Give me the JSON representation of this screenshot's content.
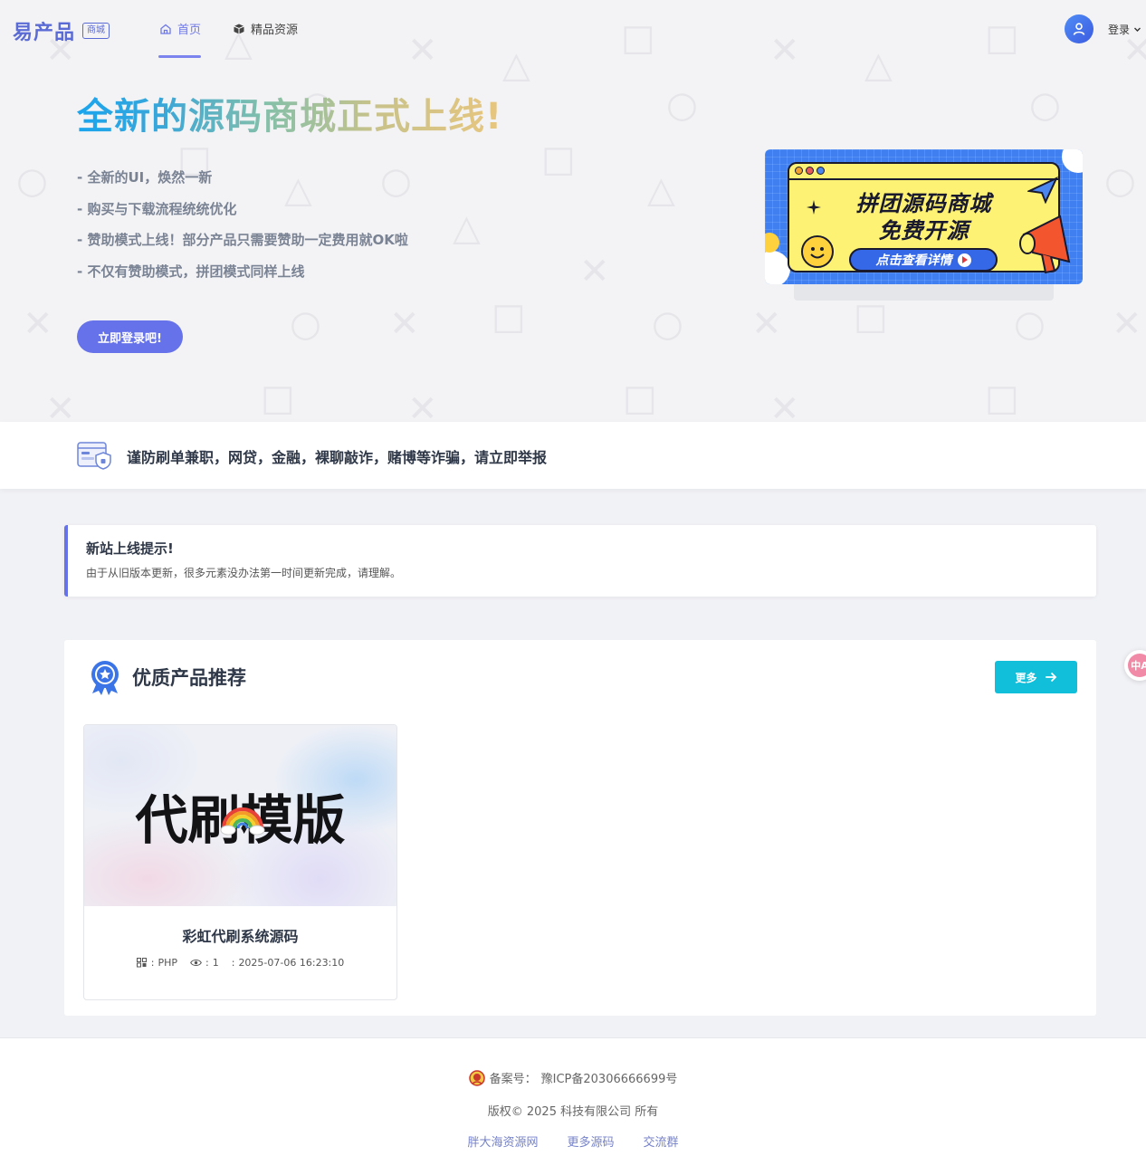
{
  "nav": {
    "logo": "易产品",
    "logo_badge": "商城",
    "items": [
      {
        "label": "首页",
        "icon": "home-icon",
        "active": true
      },
      {
        "label": "精品资源",
        "icon": "box-icon",
        "active": false
      }
    ],
    "login_label": "登录",
    "accent_color": "#6f79e6"
  },
  "hero": {
    "title": "全新的源码商城正式上线!",
    "bullets": [
      "- 全新的UI，焕然一新",
      "- 购买与下载流程统统优化",
      "- 赞助模式上线！部分产品只需要赞助一定费用就OK啦",
      "- 不仅有赞助模式，拼团模式同样上线"
    ],
    "cta_label": "立即登录吧!",
    "cta_color": "#6672ea",
    "banner": {
      "line1": "拼团源码商城",
      "line2": "免费开源",
      "button": "点击查看详情"
    }
  },
  "notice": {
    "text": "谨防刷单兼职，网贷，金融，裸聊敲诈，赌博等诈骗，请立即举报"
  },
  "alert": {
    "title": "新站上线提示!",
    "desc": "由于从旧版本更新，很多元素没办法第一时间更新完成，请理解。"
  },
  "section": {
    "title": "优质产品推荐",
    "more_label": "更多",
    "more_color": "#11bfdb",
    "products": [
      {
        "thumb_text": "代刷模版",
        "name": "彩虹代刷系统源码",
        "lang": "PHP",
        "views": "1",
        "date": "2025-07-06 16:23:10"
      }
    ]
  },
  "side_widget": {
    "label": "中A"
  },
  "footer": {
    "icp_label": "备案号：",
    "icp_value": "豫ICP备20306666699号",
    "copyright": "版权© 2025 科技有限公司 所有",
    "links": [
      "胖大海资源网",
      "更多源码",
      "交流群"
    ]
  }
}
